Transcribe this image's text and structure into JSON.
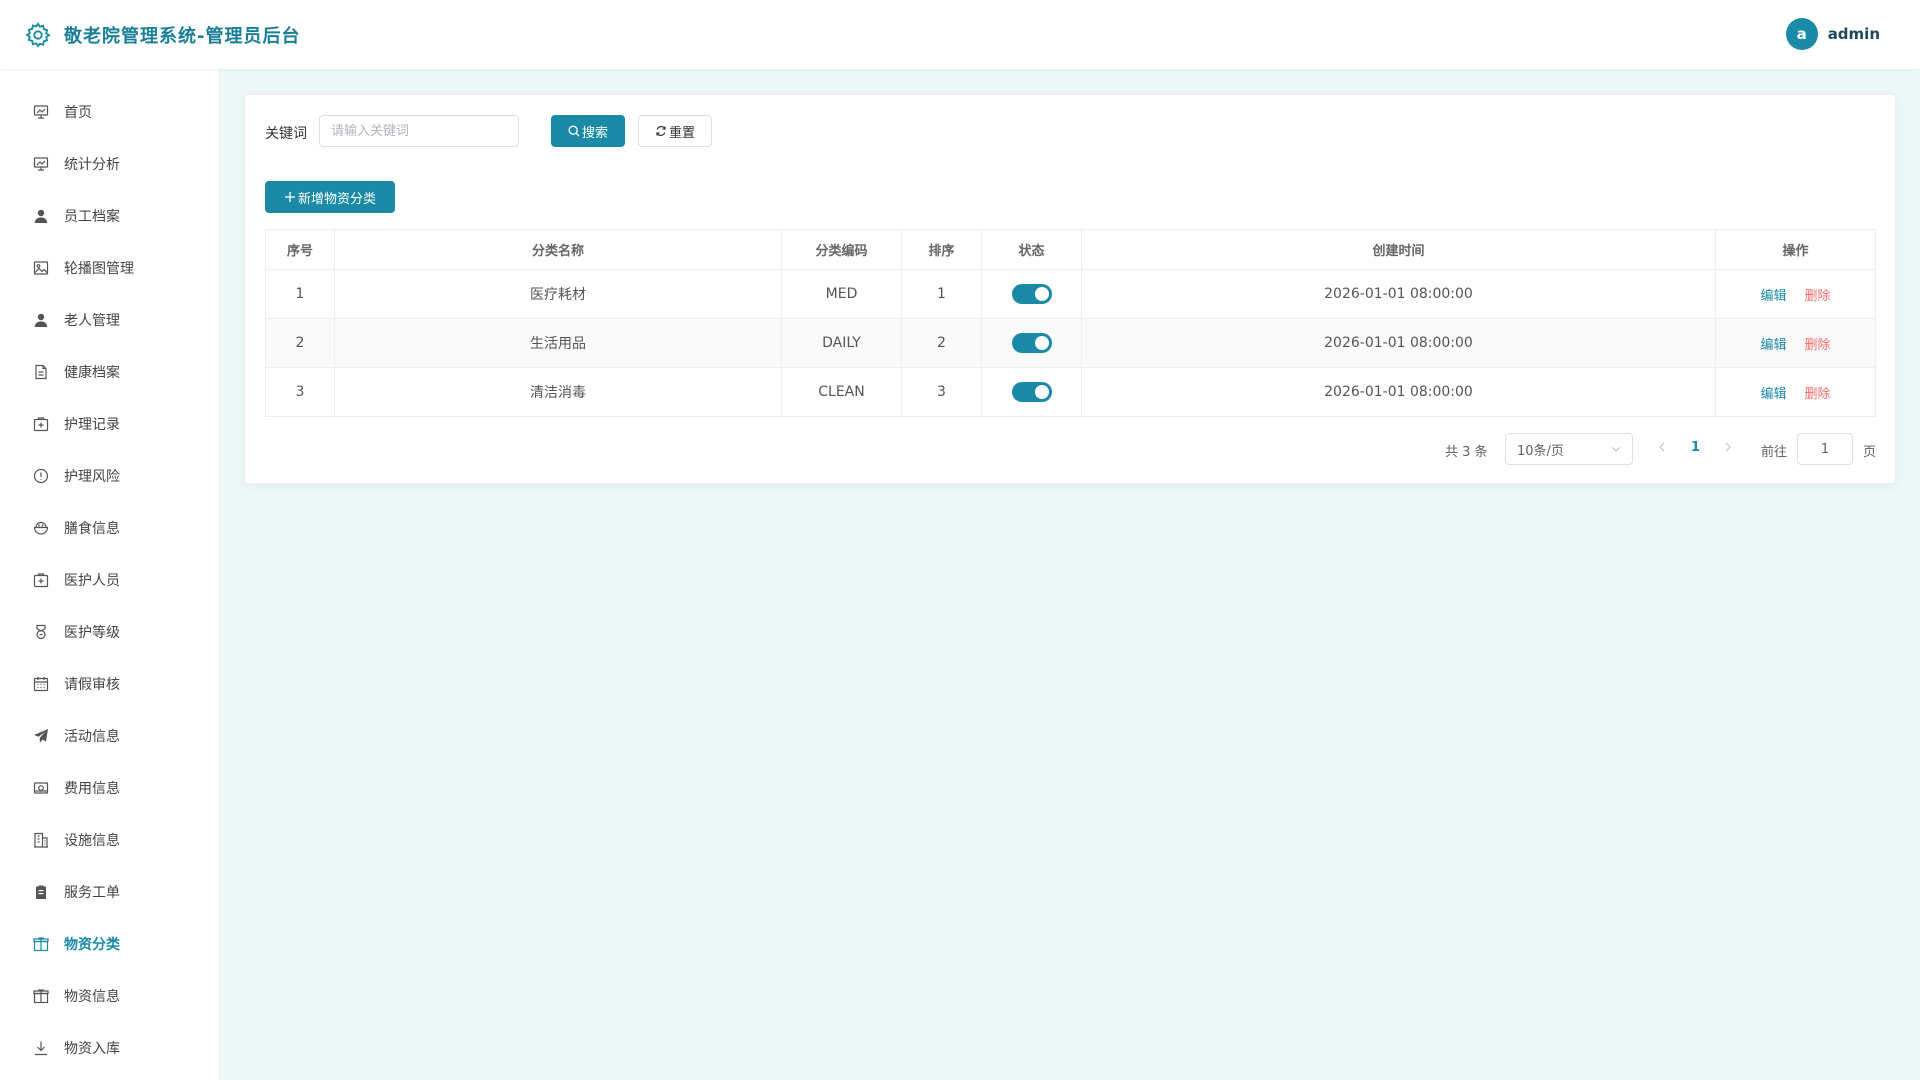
{
  "header": {
    "title": "敬老院管理系统-管理员后台",
    "avatar_letter": "a",
    "username": "admin"
  },
  "sidebar": {
    "items": [
      {
        "label": "首页",
        "icon": "chart-icon"
      },
      {
        "label": "统计分析",
        "icon": "chart-icon"
      },
      {
        "label": "员工档案",
        "icon": "user-icon"
      },
      {
        "label": "轮播图管理",
        "icon": "image-icon"
      },
      {
        "label": "老人管理",
        "icon": "user-icon"
      },
      {
        "label": "健康档案",
        "icon": "document-icon"
      },
      {
        "label": "护理记录",
        "icon": "medical-box-icon"
      },
      {
        "label": "护理风险",
        "icon": "warning-icon"
      },
      {
        "label": "膳食信息",
        "icon": "bowl-icon"
      },
      {
        "label": "医护人员",
        "icon": "medical-box-icon"
      },
      {
        "label": "医护等级",
        "icon": "medal-icon"
      },
      {
        "label": "请假审核",
        "icon": "calendar-icon"
      },
      {
        "label": "活动信息",
        "icon": "send-icon"
      },
      {
        "label": "费用信息",
        "icon": "money-icon"
      },
      {
        "label": "设施信息",
        "icon": "building-icon"
      },
      {
        "label": "服务工单",
        "icon": "clipboard-icon"
      },
      {
        "label": "物资分类",
        "icon": "box-icon",
        "active": true
      },
      {
        "label": "物资信息",
        "icon": "box-icon"
      },
      {
        "label": "物资入库",
        "icon": "download-icon"
      }
    ]
  },
  "filter": {
    "keyword_label": "关键词",
    "keyword_placeholder": "请输入关键词",
    "keyword_value": "",
    "search_label": "搜索",
    "reset_label": "重置"
  },
  "toolbar": {
    "add_label": "新增物资分类"
  },
  "table": {
    "columns": [
      "序号",
      "分类名称",
      "分类编码",
      "排序",
      "状态",
      "创建时间",
      "操作"
    ],
    "rows": [
      {
        "index": "1",
        "name": "医疗耗材",
        "code": "MED",
        "sort": "1",
        "status": true,
        "created": "2026-01-01 08:00:00"
      },
      {
        "index": "2",
        "name": "生活用品",
        "code": "DAILY",
        "sort": "2",
        "status": true,
        "created": "2026-01-01 08:00:00"
      },
      {
        "index": "3",
        "name": "清洁消毒",
        "code": "CLEAN",
        "sort": "3",
        "status": true,
        "created": "2026-01-01 08:00:00"
      }
    ],
    "edit_label": "编辑",
    "delete_label": "删除"
  },
  "pagination": {
    "total_text": "共 3 条",
    "page_size": "10条/页",
    "current_page": "1",
    "goto_label": "前往",
    "goto_value": "1",
    "page_label": "页"
  },
  "colors": {
    "accent": "#1a8aa6",
    "danger": "#f56c6c",
    "background": "#eef9f7"
  }
}
